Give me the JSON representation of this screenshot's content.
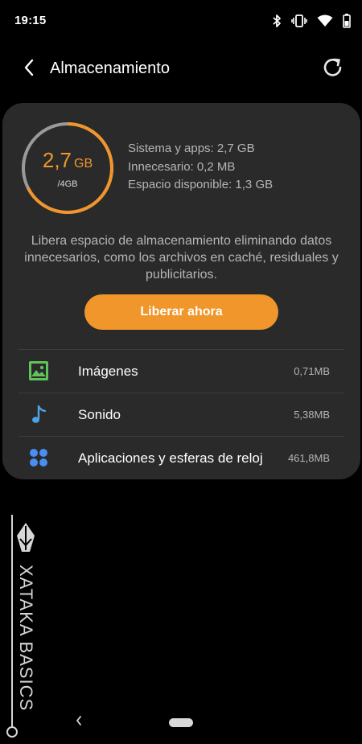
{
  "status_bar": {
    "time": "19:15",
    "icons": [
      "bluetooth-icon",
      "vibrate-icon",
      "wifi-icon",
      "battery-icon"
    ]
  },
  "header": {
    "title": "Almacenamiento",
    "back_icon": "chevron-left-icon",
    "refresh_icon": "refresh-icon"
  },
  "storage": {
    "used_value": "2,7",
    "used_unit": "GB",
    "total": "/4GB",
    "used_fraction": 0.675,
    "stats": [
      "Sistema y apps: 2,7 GB",
      "Innecesario: 0,2 MB",
      "Espacio disponible: 1,3 GB"
    ],
    "description": "Libera espacio de almacenamiento eliminando datos innecesarios, como los archivos en caché, residuales y publicitarios.",
    "free_button_label": "Liberar ahora"
  },
  "categories": [
    {
      "label": "Imágenes",
      "size": "0,71MB",
      "icon": "image-icon"
    },
    {
      "label": "Sonido",
      "size": "5,38MB",
      "icon": "music-note-icon"
    },
    {
      "label": "Aplicaciones y esferas de reloj",
      "size": "461,8MB",
      "icon": "apps-icon"
    }
  ],
  "watermark": {
    "text": "XATAKA BASICS"
  },
  "colors": {
    "accent": "#f0962a",
    "card_bg": "#2a2a2a",
    "image_icon": "#5fc35a",
    "sound_icon": "#4da3e6",
    "apps_icon": "#4a8ef0"
  }
}
